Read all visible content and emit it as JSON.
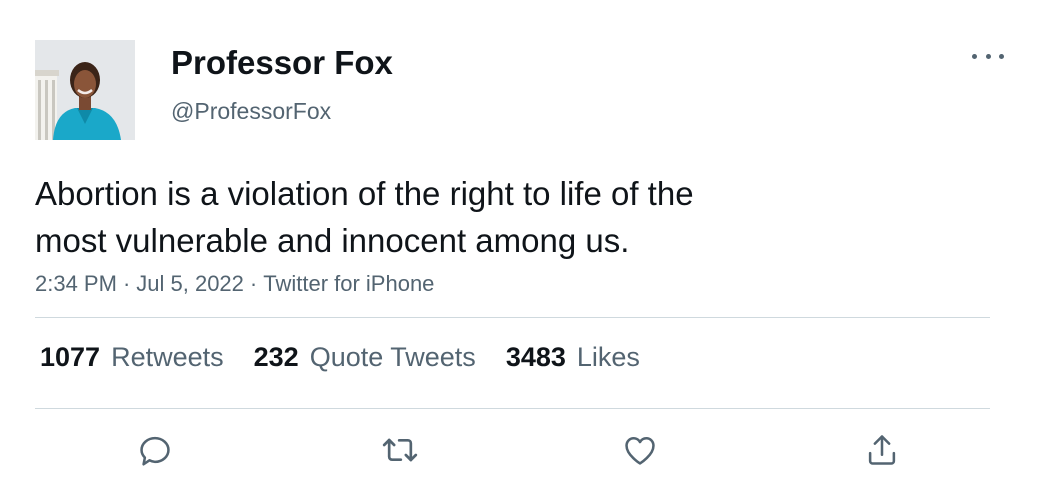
{
  "author": {
    "display_name": "Professor Fox",
    "handle": "@ProfessorFox"
  },
  "tweet": {
    "text_lines": [
      "Abortion is a violation of the right to life of the",
      "most vulnerable and innocent among us."
    ],
    "time": "2:34 PM",
    "date": "Jul 5, 2022",
    "source": "Twitter for iPhone",
    "separator": "·"
  },
  "stats": {
    "retweets": {
      "count": "1077",
      "label": "Retweets"
    },
    "quote_tweets": {
      "count": "232",
      "label": "Quote Tweets"
    },
    "likes": {
      "count": "3483",
      "label": "Likes"
    }
  },
  "actions": {
    "icons": [
      "reply-icon",
      "retweet-icon",
      "like-icon",
      "share-icon"
    ]
  },
  "colors": {
    "text_primary": "#0f1419",
    "text_secondary": "#536471",
    "divider": "#cfd9de",
    "background": "#ffffff"
  }
}
